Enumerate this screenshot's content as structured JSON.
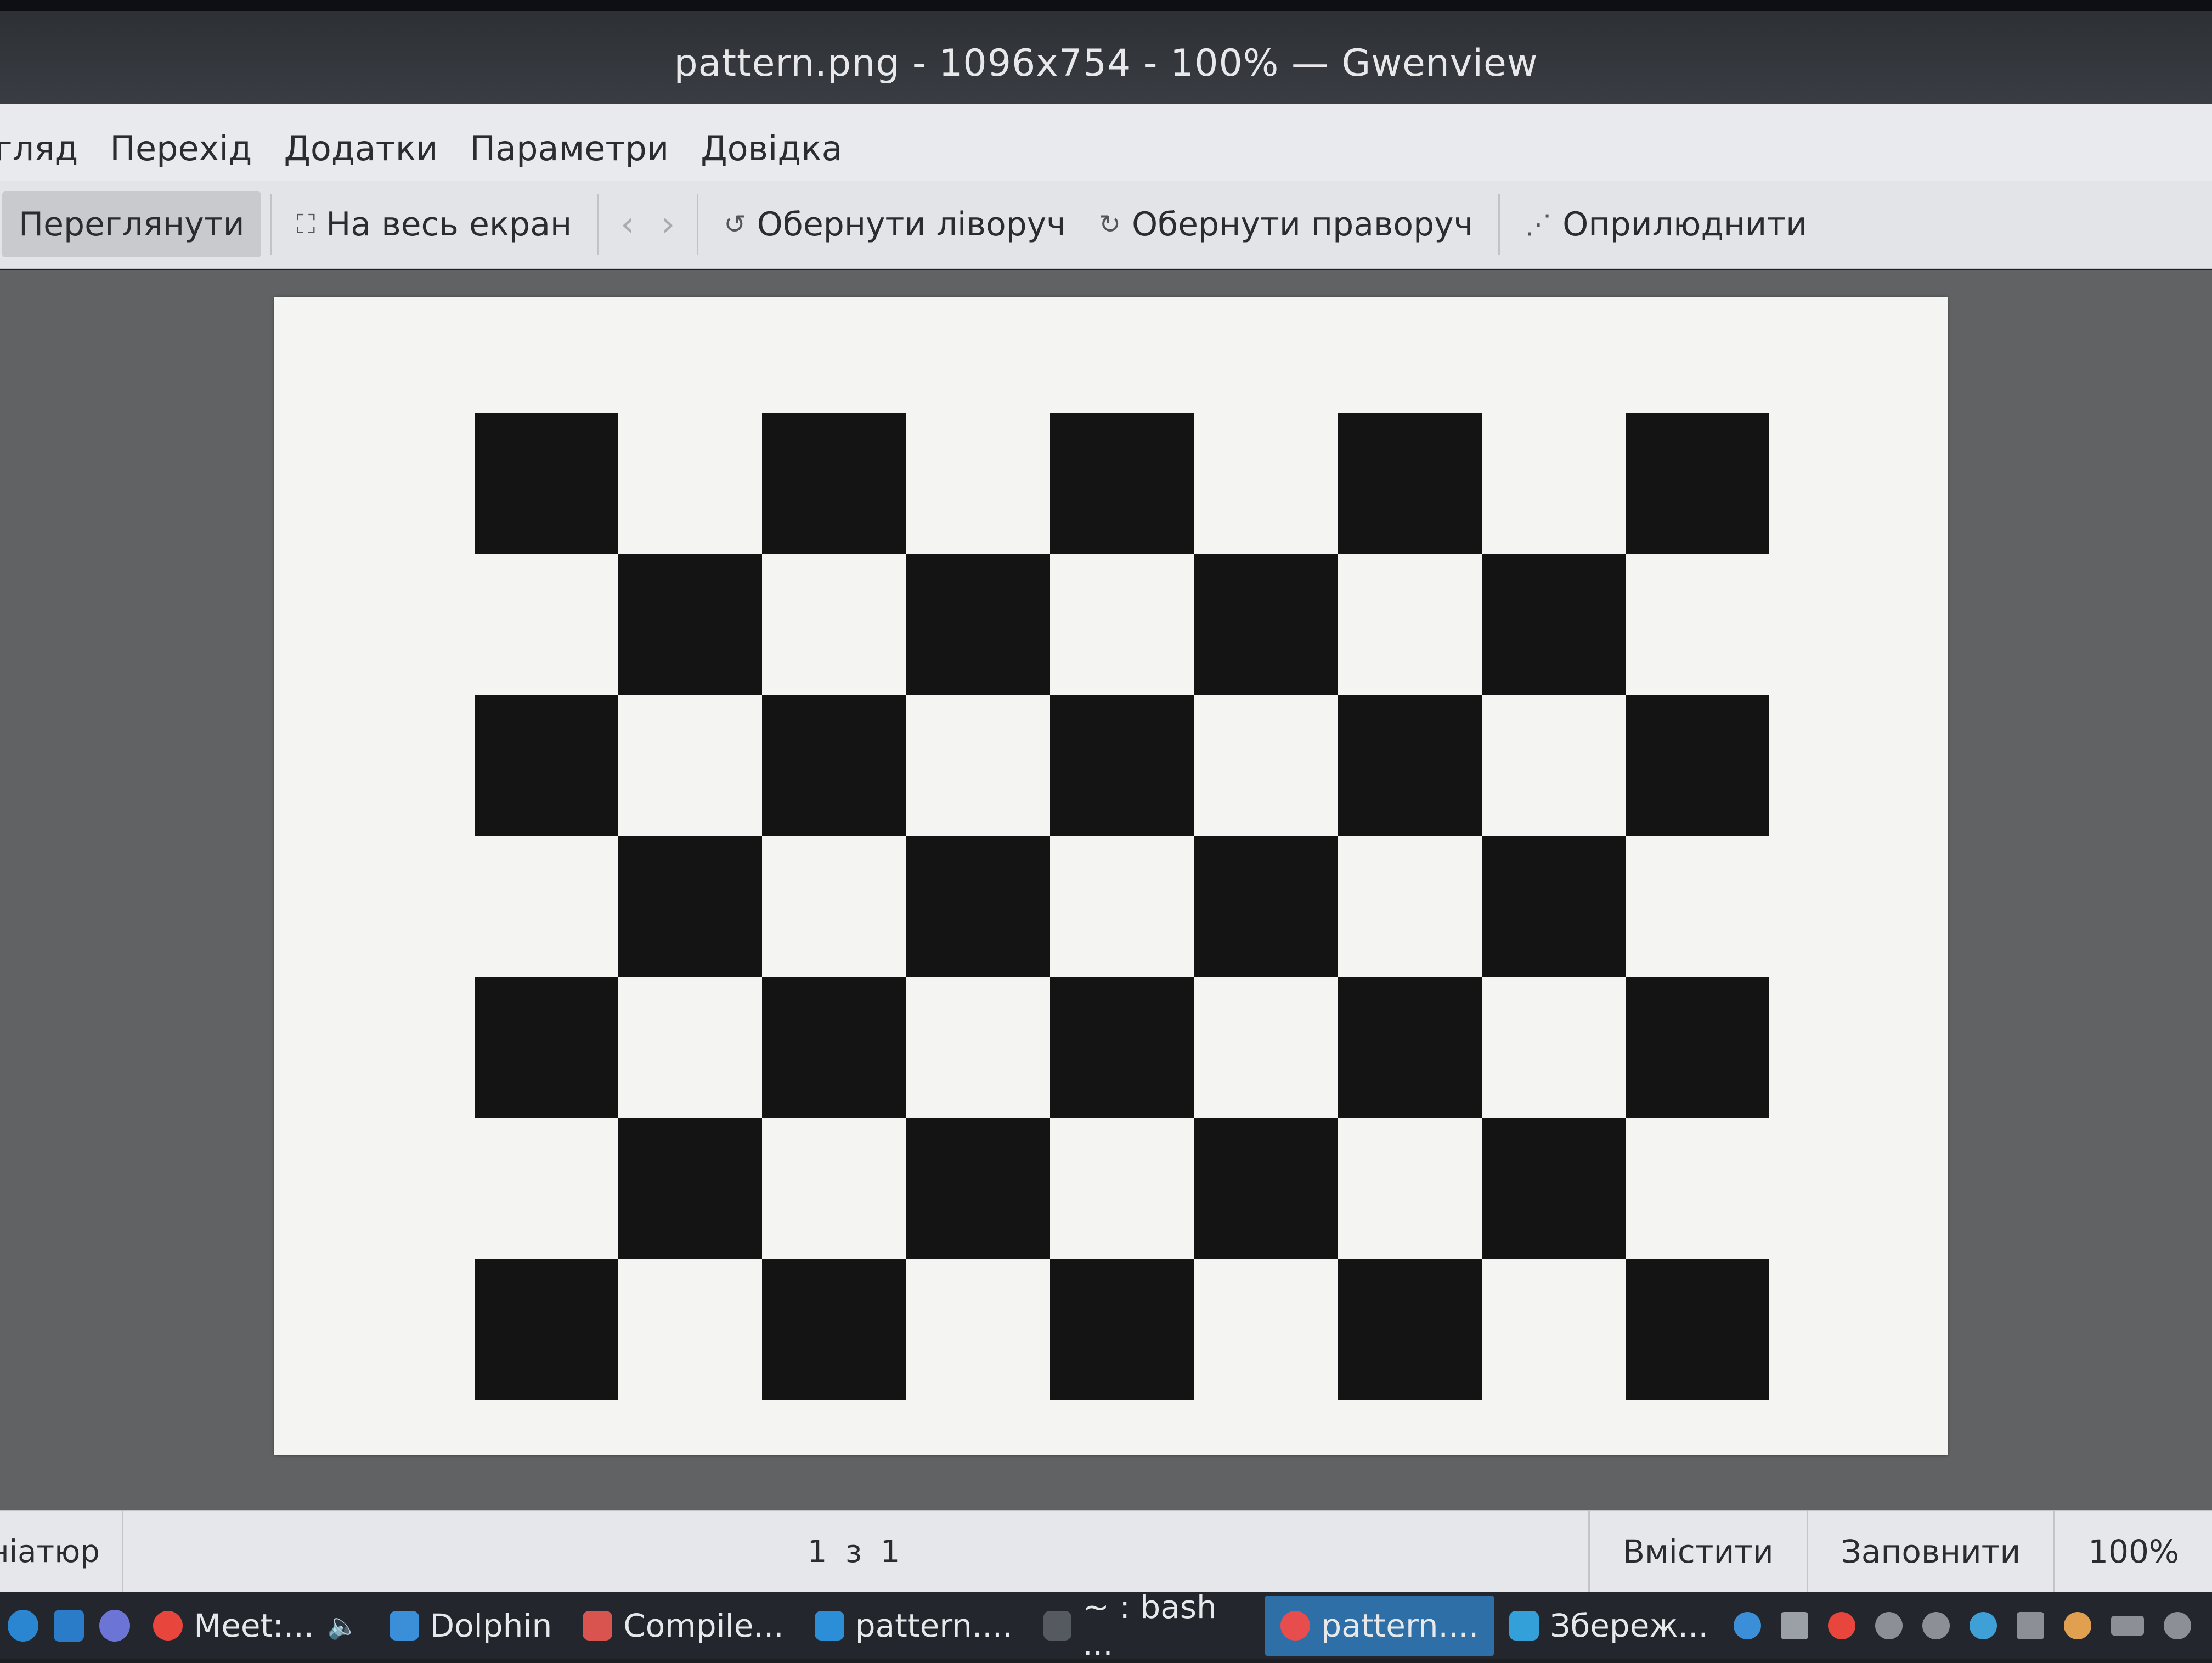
{
  "window": {
    "title": "pattern.png - 1096x754 - 100% — Gwenview"
  },
  "menu": {
    "items": [
      "гляд",
      "Перехід",
      "Додатки",
      "Параметри",
      "Довідка"
    ]
  },
  "toolbar": {
    "browse_label": "Переглянути",
    "fullscreen_label": "На весь екран",
    "rotate_left_label": "Обернути ліворуч",
    "rotate_right_label": "Обернути праворуч",
    "share_label": "Оприлюднити"
  },
  "image": {
    "rows": 7,
    "cols": 9,
    "first_cell_dark": true,
    "dark_color": "#141414",
    "light_color": "#f4f4f3"
  },
  "statusbar": {
    "thumbnails_label": "ніатюр",
    "page_count": "1 з 1",
    "fit_label": "Вмістити",
    "fill_label": "Заповнити",
    "zoom": "100%"
  },
  "taskbar": {
    "tasks": [
      {
        "label": "Meet:...",
        "icon": "chrome-icon",
        "color": "#e8453c"
      },
      {
        "label": "Dolphin",
        "icon": "dolphin-icon",
        "color": "#3a8fd8"
      },
      {
        "label": "Compile...",
        "icon": "compiler-icon",
        "color": "#d9534f"
      },
      {
        "label": "pattern....",
        "icon": "vscode-icon",
        "color": "#2c8ed6"
      },
      {
        "label": "~ : bash ...",
        "icon": "terminal-icon",
        "color": "#555a61"
      },
      {
        "label": "pattern....",
        "icon": "gwenview-icon",
        "color": "#e74d4d"
      },
      {
        "label": "Збереж...",
        "icon": "save-icon",
        "color": "#33a0d9"
      }
    ]
  }
}
